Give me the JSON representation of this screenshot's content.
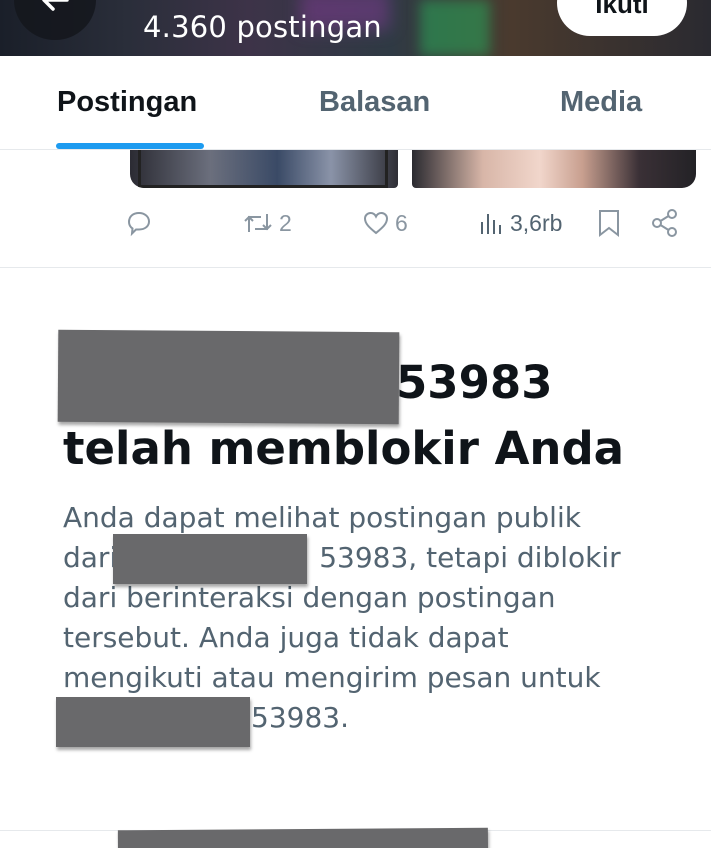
{
  "header": {
    "post_count": "4.360 postingan",
    "follow_label": "Ikuti"
  },
  "tabs": [
    {
      "label": "Postingan",
      "active": true
    },
    {
      "label": "Balasan",
      "active": false
    },
    {
      "label": "Media",
      "active": false
    }
  ],
  "tweet_actions": {
    "reply_icon": "reply-icon",
    "retweet_count": "2",
    "like_count": "6",
    "views_count": "3,6rb",
    "bookmark_icon": "bookmark-icon",
    "share_icon": "share-icon"
  },
  "blocked": {
    "title_line1_suffix": "53983",
    "title_line2": "telah memblokir Anda",
    "desc_line1": "Anda dapat melihat postingan publik",
    "desc_line2_prefix": "dari",
    "desc_line2_suffix": "53983, tetapi diblokir",
    "desc_line3": "dari berinteraksi dengan postingan",
    "desc_line4": "tersebut. Anda juga tidak dapat",
    "desc_line5": "mengikuti atau mengirim pesan untuk",
    "desc_line6_suffix": "53983."
  },
  "colors": {
    "accent": "#1d9bf0",
    "text_primary": "#0f1419",
    "text_secondary": "#536471",
    "redaction": "#69696b"
  }
}
